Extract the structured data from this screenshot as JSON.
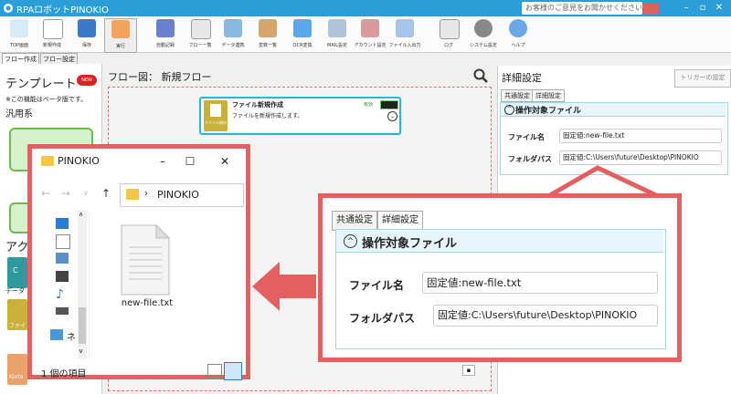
{
  "window": {
    "title": "RPAロボットPINOKIO",
    "feedback": "お客様のご意見をお聞かせください"
  },
  "toolbar": {
    "items": [
      "TOP画面",
      "新規作成",
      "保存",
      "実行",
      "自動記録",
      "フロー一覧",
      "データ連携",
      "変数一覧",
      "OCR変換",
      "MAIL設定",
      "アカウント設定",
      "ファイル入出力",
      "ログ",
      "システム設定",
      "ヘルプ"
    ]
  },
  "left": {
    "tabs": [
      "フロー作成",
      "フロー設定"
    ],
    "template_title": "テンプレート",
    "new_badge": "NEW",
    "beta_note": "※この機能はベータ版です。",
    "general": "汎用系",
    "activity_title": "アクティ",
    "side_labels": [
      "C",
      "データ",
      "ファイ",
      "Kinto"
    ]
  },
  "flow": {
    "title": "フロー図： 新規フロー",
    "node": {
      "title": "ファイル新規作成",
      "desc": "ファイルを新規作成します。",
      "icon_label": "ファイル操作",
      "enabled": "有効"
    }
  },
  "detail": {
    "title": "詳細設定",
    "trigger": "トリガーの設定",
    "tabs": [
      "共通設定",
      "詳細設定"
    ],
    "section": "操作対象ファイル",
    "file_label": "ファイル名",
    "file_value": "固定値:new-file.txt",
    "folder_label": "フォルダパス",
    "folder_value": "固定値:C:\\Users\\future\\Desktop\\PINOKIO"
  },
  "explorer": {
    "title": "PINOKIO",
    "address": "PINOKIO",
    "file": "new-file.txt",
    "status": "1 個の項目",
    "side_net": "ネ"
  },
  "colors": {
    "accent": "#2b9ed8",
    "callout": "#e45f5f"
  }
}
